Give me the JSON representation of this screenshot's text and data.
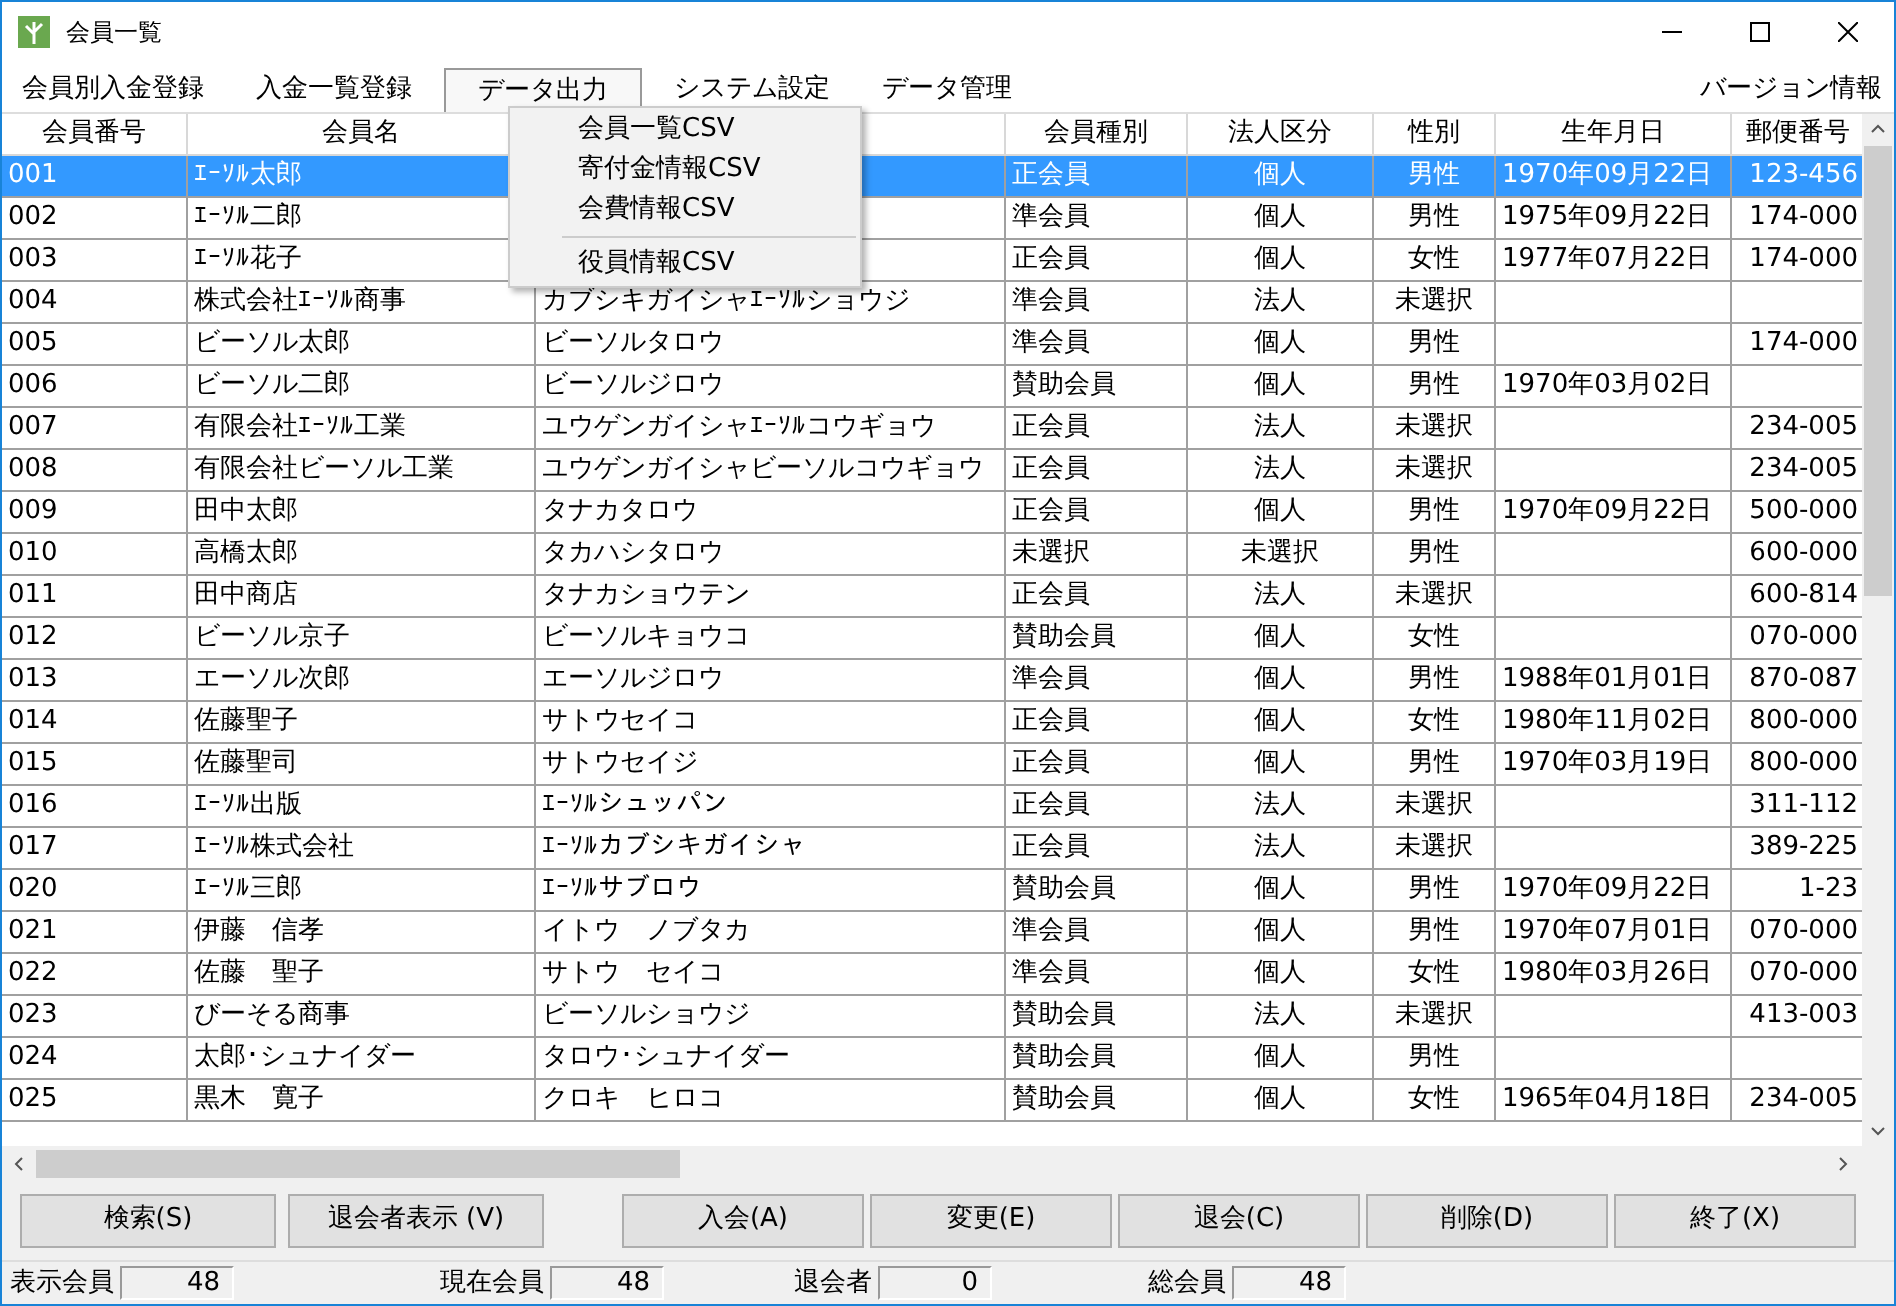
{
  "window": {
    "title": "会員一覧"
  },
  "menubar": [
    {
      "label": "会員別入金登録",
      "selected": false
    },
    {
      "label": "入金一覧登録",
      "selected": false
    },
    {
      "label": "データ出力",
      "selected": true
    },
    {
      "label": "システム設定",
      "selected": false
    },
    {
      "label": "データ管理",
      "selected": false
    },
    {
      "label": "バージョン情報",
      "selected": false
    }
  ],
  "dropdown": [
    {
      "kind": "item",
      "label": "会員一覧CSV"
    },
    {
      "kind": "item",
      "label": "寄付金情報CSV"
    },
    {
      "kind": "item",
      "label": "会費情報CSV"
    },
    {
      "kind": "separator"
    },
    {
      "kind": "item",
      "label": "役員情報CSV"
    }
  ],
  "table": {
    "columns": [
      "会員番号",
      "会員名",
      "会員種別",
      "法人区分",
      "性別",
      "生年月日",
      "郵便番号"
    ],
    "rows": [
      {
        "id": "001",
        "name": "ｴｰｿﾙ太郎",
        "type": "正会員",
        "corp": "個人",
        "gender": "男性",
        "birth": "1970年09月22日",
        "zip": "123-456",
        "selected": true
      },
      {
        "id": "002",
        "name": "ｴｰｿﾙ二郎",
        "type": "準会員",
        "corp": "個人",
        "gender": "男性",
        "birth": "1975年09月22日",
        "zip": "174-000",
        "selected": false
      },
      {
        "id": "003",
        "name": "ｴｰｿﾙ花子",
        "type": "正会員",
        "corp": "個人",
        "gender": "女性",
        "birth": "1977年07月22日",
        "zip": "174-000",
        "selected": false
      },
      {
        "id": "004",
        "name": "株式会社ｴｰｿﾙ商事",
        "kana": "カブシキガイシャｴｰｿﾙショウジ",
        "type": "準会員",
        "corp": "法人",
        "gender": "未選択",
        "selected": false
      },
      {
        "id": "005",
        "name": "ビーソル太郎",
        "kana": "ビーソルタロウ",
        "type": "準会員",
        "corp": "個人",
        "gender": "男性",
        "zip": "174-000",
        "selected": false
      },
      {
        "id": "006",
        "name": "ビーソル二郎",
        "kana": "ビーソルジロウ",
        "type": "賛助会員",
        "corp": "個人",
        "gender": "男性",
        "birth": "1970年03月02日",
        "selected": false
      },
      {
        "id": "007",
        "name": "有限会社ｴｰｿﾙ工業",
        "kana": "ユウゲンガイシャｴｰｿﾙコウギョウ",
        "type": "正会員",
        "corp": "法人",
        "gender": "未選択",
        "zip": "234-005",
        "selected": false
      },
      {
        "id": "008",
        "name": "有限会社ビーソル工業",
        "kana": "ユウゲンガイシャビーソルコウギョウ",
        "type": "正会員",
        "corp": "法人",
        "gender": "未選択",
        "zip": "234-005",
        "selected": false
      },
      {
        "id": "009",
        "name": "田中太郎",
        "kana": "タナカタロウ",
        "type": "正会員",
        "corp": "個人",
        "gender": "男性",
        "birth": "1970年09月22日",
        "zip": "500-000",
        "selected": false
      },
      {
        "id": "010",
        "name": "高橋太郎",
        "kana": "タカハシタロウ",
        "type": "未選択",
        "corp": "未選択",
        "gender": "男性",
        "zip": "600-000",
        "selected": false
      },
      {
        "id": "011",
        "name": "田中商店",
        "kana": "タナカショウテン",
        "type": "正会員",
        "corp": "法人",
        "gender": "未選択",
        "zip": "600-814",
        "selected": false
      },
      {
        "id": "012",
        "name": "ビーソル京子",
        "kana": "ビーソルキョウコ",
        "type": "賛助会員",
        "corp": "個人",
        "gender": "女性",
        "zip": "070-000",
        "selected": false
      },
      {
        "id": "013",
        "name": "エーソル次郎",
        "kana": "エーソルジロウ",
        "type": "準会員",
        "corp": "個人",
        "gender": "男性",
        "birth": "1988年01月01日",
        "zip": "870-087",
        "selected": false
      },
      {
        "id": "014",
        "name": "佐藤聖子",
        "kana": "サトウセイコ",
        "type": "正会員",
        "corp": "個人",
        "gender": "女性",
        "birth": "1980年11月02日",
        "zip": "800-000",
        "selected": false
      },
      {
        "id": "015",
        "name": "佐藤聖司",
        "kana": "サトウセイジ",
        "type": "正会員",
        "corp": "個人",
        "gender": "男性",
        "birth": "1970年03月19日",
        "zip": "800-000",
        "selected": false
      },
      {
        "id": "016",
        "name": "ｴｰｿﾙ出版",
        "kana": "ｴｰｿﾙシュッパン",
        "type": "正会員",
        "corp": "法人",
        "gender": "未選択",
        "zip": "311-112",
        "selected": false
      },
      {
        "id": "017",
        "name": "ｴｰｿﾙ株式会社",
        "kana": "ｴｰｿﾙカブシキガイシャ",
        "type": "正会員",
        "corp": "法人",
        "gender": "未選択",
        "zip": "389-225",
        "selected": false
      },
      {
        "id": "020",
        "name": "ｴｰｿﾙ三郎",
        "kana": "ｴｰｿﾙサブロウ",
        "type": "賛助会員",
        "corp": "個人",
        "gender": "男性",
        "birth": "1970年09月22日",
        "zip": "1-23",
        "selected": false
      },
      {
        "id": "021",
        "name": "伊藤　信孝",
        "kana": "イトウ　ノブタカ",
        "type": "準会員",
        "corp": "個人",
        "gender": "男性",
        "birth": "1970年07月01日",
        "zip": "070-000",
        "selected": false
      },
      {
        "id": "022",
        "name": "佐藤　聖子",
        "kana": "サトウ　セイコ",
        "type": "準会員",
        "corp": "個人",
        "gender": "女性",
        "birth": "1980年03月26日",
        "zip": "070-000",
        "selected": false
      },
      {
        "id": "023",
        "name": "びーそる商事",
        "kana": "ビーソルショウジ",
        "type": "賛助会員",
        "corp": "法人",
        "gender": "未選択",
        "zip": "413-003",
        "selected": false
      },
      {
        "id": "024",
        "name": "太郎･シュナイダー",
        "kana": "タロウ･シュナイダー",
        "type": "賛助会員",
        "corp": "個人",
        "gender": "男性",
        "selected": false
      },
      {
        "id": "025",
        "name": "黒木　寛子",
        "kana": "クロキ　ヒロコ",
        "type": "賛助会員",
        "corp": "個人",
        "gender": "女性",
        "birth": "1965年04月18日",
        "zip": "234-005",
        "selected": false
      }
    ]
  },
  "left_buttons": [
    "検索(S)",
    "退会者表示 (V)"
  ],
  "right_buttons": [
    "入会(A)",
    "変更(E)",
    "退会(C)",
    "削除(D)",
    "終了(X)"
  ],
  "status": [
    {
      "label": "表示会員",
      "value": "48"
    },
    {
      "label": "現在会員",
      "value": "48"
    },
    {
      "label": "退会者",
      "value": "0"
    },
    {
      "label": "総会員",
      "value": "48"
    }
  ]
}
